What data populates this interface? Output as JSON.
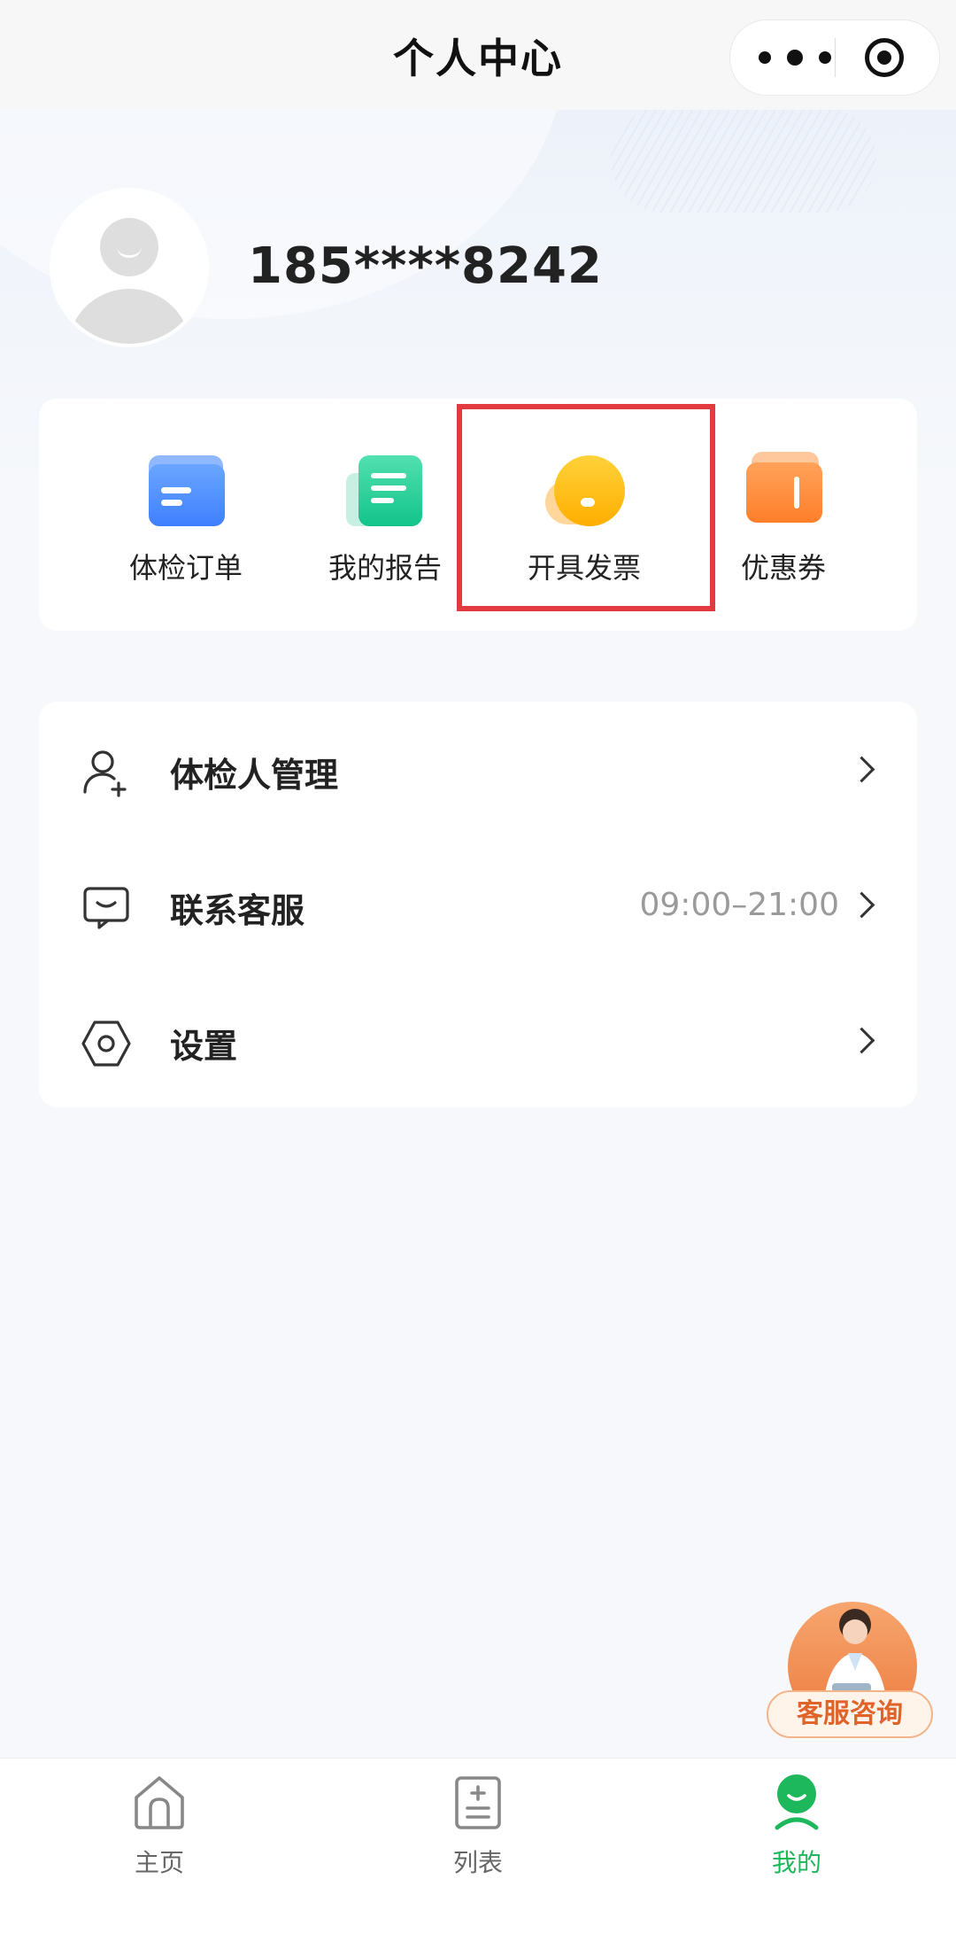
{
  "header": {
    "title": "个人中心",
    "more_icon": "more-dots-icon",
    "close_icon": "target-icon"
  },
  "profile": {
    "phone": "185****8242",
    "avatar_icon": "default-avatar-icon"
  },
  "shortcuts": [
    {
      "label": "体检订单",
      "icon": "folder-icon",
      "color": "#3f7fff"
    },
    {
      "label": "我的报告",
      "icon": "report-icon",
      "color": "#12c48a"
    },
    {
      "label": "开具发票",
      "icon": "invoice-coin-icon",
      "color": "#ffae00"
    },
    {
      "label": "优惠券",
      "icon": "coupon-icon",
      "color": "#ff7f2a"
    }
  ],
  "highlight_color": "#e33a3f",
  "menu": [
    {
      "label": "体检人管理",
      "icon": "add-person-icon",
      "extra": ""
    },
    {
      "label": "联系客服",
      "icon": "customer-service-icon",
      "extra": "09:00–21:00"
    },
    {
      "label": "设置",
      "icon": "settings-hexagon-icon",
      "extra": ""
    }
  ],
  "support_button": {
    "label": "客服咨询",
    "icon": "doctor-avatar-icon"
  },
  "tabbar": {
    "items": [
      {
        "label": "主页",
        "icon": "home-icon",
        "active": false
      },
      {
        "label": "列表",
        "icon": "list-icon",
        "active": false
      },
      {
        "label": "我的",
        "icon": "profile-face-icon",
        "active": true
      }
    ],
    "active_color": "#1db85c"
  }
}
